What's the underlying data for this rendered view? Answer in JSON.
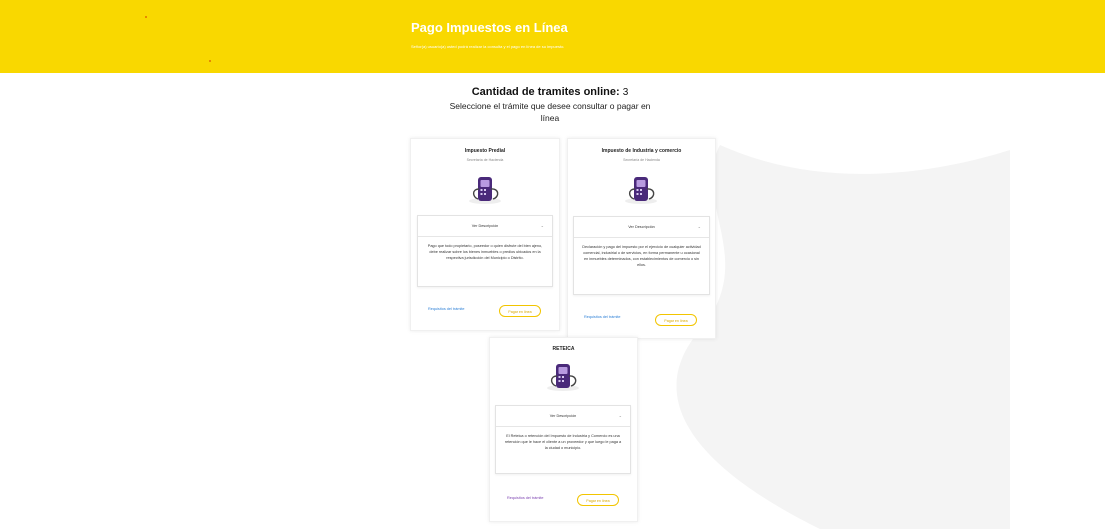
{
  "banner": {
    "title": "Pago Impuestos en Línea",
    "subtitle": "Señor(a) usuario(a) usted podrá realizar la consulta y el pago en línea de su impuesto."
  },
  "heading": {
    "count_label": "Cantidad de tramites online:",
    "count_value": "3",
    "instruction": "Seleccione el trámite que desee consultar o pagar en línea"
  },
  "cards": [
    {
      "title": "Impuesto Predial",
      "subtitle": "Secretaría de Hacienda",
      "desc_toggle": "Ver Descripción",
      "description": "Pago que todo propietario, poseedor o quien disfrute del bien ajeno, debe realizar sobre los bienes inmuebles o predios ubicados en la respectiva jurisdicción del Municipio o Distrito.",
      "requirements_link": "Requisitos del trámite",
      "pay_button": "Pagar en línea"
    },
    {
      "title": "Impuesto de Industria y comercio",
      "subtitle": "Secretaría de Hacienda",
      "desc_toggle": "Ver Descripción",
      "description": "Declaración y pago del impuesto por el ejercicio de cualquier actividad comercial, industrial o de servicios, en forma permanente u ocasional en inmuebles determinados, con establecimientos de comercio o sin ellos.",
      "requirements_link": "Requisitos del trámite",
      "pay_button": "Pagar en línea"
    },
    {
      "title": "RETEICA",
      "subtitle": "",
      "desc_toggle": "Ver Descripción",
      "description": "El Reteica o retención del Impuesto de Industria y Comercio es una retención que le hace el cliente a un proveedor y que luego le paga a la ciudad o municipio.",
      "requirements_link": "Requisitos del trámite",
      "pay_button": "Pagar en línea"
    }
  ],
  "colors": {
    "banner": "#f9d800",
    "accent_button_border": "#f2c500",
    "link_blue": "#2b7fd6",
    "link_purple": "#7a3fb0",
    "icon_purple": "#4a2a7a"
  },
  "icons": {
    "card_icon": "payment-terminal-icon",
    "chevron": "chevron-down-icon"
  }
}
